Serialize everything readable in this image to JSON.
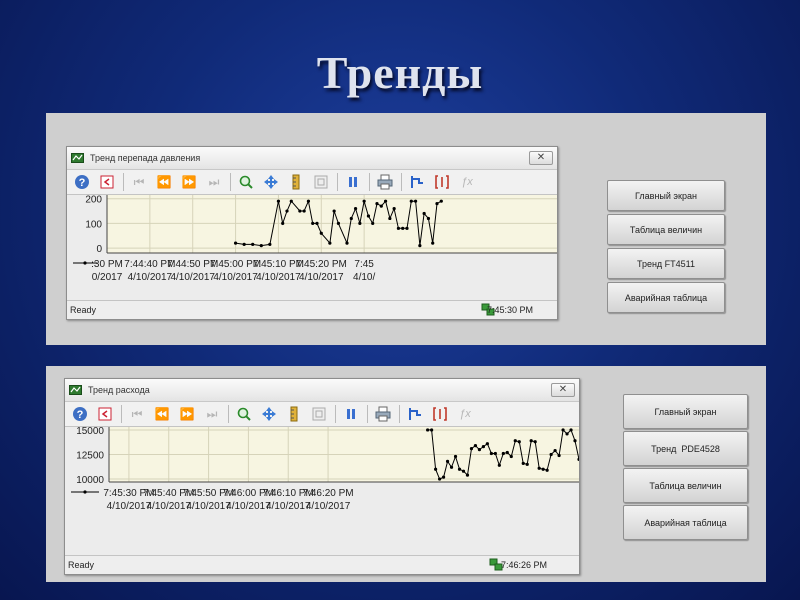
{
  "slide": {
    "title": "Тренды"
  },
  "trend1": {
    "window_title": "Тренд перепада давления",
    "status": "Ready",
    "time": "7:45:30 PM",
    "buttons": [
      "Главный экран",
      "Таблица величин",
      "Тренд FT4511",
      "Аварийная таблица"
    ],
    "y_ticks": [
      "200",
      "100",
      "0"
    ],
    "x_ticks": [
      {
        "time": ":30 PM",
        "date": "0/2017"
      },
      {
        "time": "7:44:40 PM",
        "date": "4/10/2017"
      },
      {
        "time": "7:44:50 PM",
        "date": "4/10/2017"
      },
      {
        "time": "7:45:00 PM",
        "date": "4/10/2017"
      },
      {
        "time": "7:45:10 PM",
        "date": "4/10/2017"
      },
      {
        "time": "7:45:20 PM",
        "date": "4/10/2017"
      },
      {
        "time": "7:45",
        "date": "4/10/"
      }
    ]
  },
  "trend2": {
    "window_title": "Тренд расхода",
    "status": "Ready",
    "time": "7:46:26 PM",
    "buttons": [
      "Главный экран",
      "Тренд  PDE4528",
      "Таблица величин",
      "Аварийная таблица"
    ],
    "y_ticks": [
      "15000",
      "12500",
      "10000"
    ],
    "x_ticks": [
      {
        "time": "7:45:30 PM",
        "date": "4/10/2017"
      },
      {
        "time": "7:45:40 PM",
        "date": "4/10/2017"
      },
      {
        "time": "7:45:50 PM",
        "date": "4/10/2017"
      },
      {
        "time": "7:46:00 PM",
        "date": "4/10/2017"
      },
      {
        "time": "7:46:10 PM",
        "date": "4/10/2017"
      },
      {
        "time": "7:46:20 PM",
        "date": "4/10/2017"
      }
    ]
  },
  "chart_data": [
    {
      "type": "line",
      "ylim": [
        -20,
        215
      ],
      "x_range_seconds": [
        -30,
        75
      ],
      "series": [
        {
          "x": [
            0,
            2,
            4,
            6,
            8,
            10,
            11,
            12,
            13,
            15,
            16,
            17,
            18,
            19,
            20,
            22,
            23,
            24,
            26,
            27,
            28,
            29,
            30,
            31,
            32,
            33,
            34,
            35,
            36,
            37,
            38,
            39,
            40,
            41,
            42,
            43,
            44,
            45,
            46,
            47,
            48
          ],
          "values": [
            20,
            15,
            15,
            10,
            15,
            190,
            100,
            150,
            190,
            150,
            150,
            190,
            100,
            100,
            60,
            20,
            150,
            100,
            20,
            120,
            160,
            100,
            190,
            130,
            100,
            180,
            170,
            190,
            120,
            160,
            80,
            80,
            80,
            190,
            190,
            10,
            140,
            120,
            20,
            180,
            190
          ]
        }
      ]
    },
    {
      "type": "line",
      "ylim": [
        9700,
        15300
      ],
      "x_range_seconds": [
        -5,
        113
      ],
      "series": [
        {
          "x": [
            75,
            76,
            77,
            78,
            79,
            80,
            81,
            82,
            83,
            84,
            85,
            86,
            87,
            88,
            89,
            90,
            91,
            92,
            93,
            94,
            95,
            96,
            97,
            98,
            99,
            100,
            101,
            102,
            103,
            104,
            105,
            106,
            107,
            108,
            109,
            110,
            111,
            112,
            113
          ],
          "values": [
            15000,
            15000,
            11000,
            10000,
            10200,
            11800,
            11200,
            12300,
            11000,
            10800,
            10400,
            13100,
            13400,
            13000,
            13300,
            13600,
            12600,
            12600,
            11400,
            12600,
            12700,
            12300,
            13900,
            13800,
            11600,
            11500,
            13900,
            13800,
            11100,
            11000,
            10900,
            12500,
            12900,
            12400,
            15000,
            14600,
            15000,
            13900,
            12000
          ]
        }
      ]
    }
  ]
}
